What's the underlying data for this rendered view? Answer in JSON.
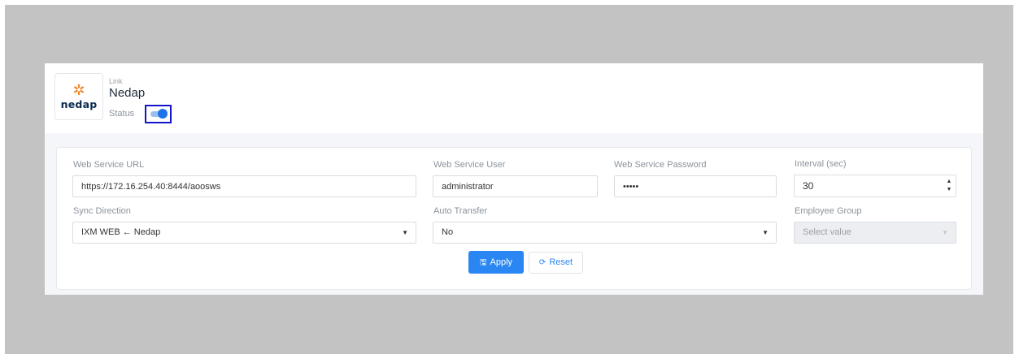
{
  "header": {
    "logo_text": "nedap",
    "link_caption": "Link",
    "link_name": "Nedap",
    "status_label": "Status",
    "status_enabled": true
  },
  "form": {
    "web_service_url": {
      "label": "Web Service URL",
      "value": "https://172.16.254.40:8444/aoosws"
    },
    "web_service_user": {
      "label": "Web Service User",
      "value": "administrator"
    },
    "web_service_password": {
      "label": "Web Service Password",
      "value": "passw"
    },
    "interval": {
      "label": "Interval (sec)",
      "value": "30"
    },
    "sync_direction": {
      "label": "Sync Direction",
      "value": "IXM WEB ← Nedap"
    },
    "auto_transfer": {
      "label": "Auto Transfer",
      "value": "No"
    },
    "employee_group": {
      "label": "Employee Group",
      "placeholder": "Select value"
    }
  },
  "actions": {
    "apply_label": "Apply",
    "reset_label": "Reset"
  },
  "colors": {
    "accent": "#2a86f2",
    "toggle_on": "#1e73e8",
    "highlight_frame": "#1414c8",
    "logo_star": "#f0852a",
    "logo_text": "#0b2a4f"
  },
  "icons": {
    "logo": "nedap-star-logo",
    "apply": "save-icon",
    "reset": "refresh-icon",
    "select": "chevron-down-icon",
    "stepper": "stepper-arrows-icon"
  }
}
